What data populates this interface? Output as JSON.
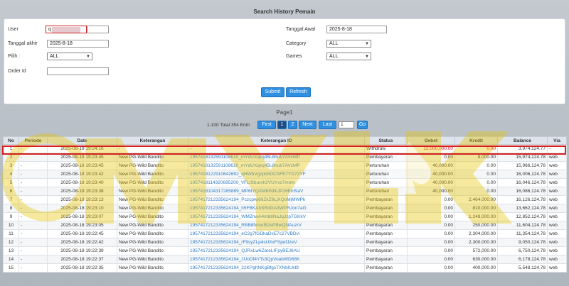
{
  "page_title": "Search History Pemain",
  "form": {
    "user_label": "User",
    "user_value": "q",
    "tanggal_awal_label": "Tanggal Awal",
    "tanggal_awal_value": "2025-8-18",
    "tanggal_akhir_label": "Tanggal akhir",
    "tanggal_akhir_value": "2025-8-18",
    "category_label": "Category",
    "category_value": "ALL",
    "pilih_label": "Pilih :",
    "pilih_value": "ALL",
    "games_label": "Games",
    "games_value": "ALL",
    "order_label": "Order Id",
    "order_value": "",
    "submit_label": "Submit",
    "refresh_label": "Refresh"
  },
  "pagination": {
    "page_label": "Page1",
    "range_text": "1-100 Total 354 Entri",
    "first_label": "First",
    "page1": "1",
    "page2": "2",
    "next_label": "Next",
    "last_label": "Last",
    "goto_value": "1",
    "go_label": "Go"
  },
  "table": {
    "headers": [
      "No",
      "Periode",
      "Date",
      "Keterangan",
      "Keterangan ID",
      "Status",
      "Debet",
      "Kredit",
      "Balance",
      "Via"
    ],
    "rows": [
      [
        "1",
        "-",
        "2025-08-18 19:24:16",
        "-",
        "-",
        "Withdraw",
        "12,000,000.00",
        "0.00",
        "3,974,124.77",
        "-"
      ],
      [
        "2",
        "-",
        "2025-08-18 19:23:45",
        "New PG-Wild Bandito",
        "1957418132591108610_mYdUXqkq45L8hub7AVcMP",
        "Pembayaran",
        "0.00",
        "8,000.00",
        "15,974,124.78",
        "web"
      ],
      [
        "3",
        "-",
        "2025-08-18 19:23:45",
        "New PG-Wild Bandito",
        "1957418132591108610_mYdUXqkq45L8hub7AVcMP",
        "Perturuhan",
        "40,000.00",
        "0.00",
        "15,966,124.78",
        "web"
      ],
      [
        "4",
        "-",
        "2025-08-18 19:23:42",
        "New PG-Wild Bandito",
        "1957418122910642692_qHWbVgzpb5DCSFE7YD72YF",
        "Perturuhan",
        "40,000.00",
        "0.00",
        "16,006,124.78",
        "web"
      ],
      [
        "5",
        "-",
        "2025-08-18 19:23:40",
        "New PG-Wild Bandito",
        "1957418114320695200_VFLtSburxh2VUYxz7mnm",
        "Perturuhan",
        "40,000.00",
        "0.00",
        "16,046,124.78",
        "web"
      ],
      [
        "6",
        "-",
        "2025-08-18 19:23:38",
        "New PG-Wild Bandito",
        "1957418104317285889_MP6tYQXMbINNiJP26EnSlaV",
        "Perturuhan",
        "40,000.00",
        "0.00",
        "16,086,124.78",
        "web"
      ],
      [
        "7",
        "-",
        "2025-08-18 19:23:13",
        "New PG-Wild Bandito",
        "1957417212335624194_Pczcpwj69ZkZ9LjXQoMjMWPk",
        "Pembayaran",
        "0.00",
        "2,464,000.00",
        "16,126,124.78",
        "web"
      ],
      [
        "8",
        "-",
        "2025-08-18 19:23:10",
        "New PG-Wild Bandito",
        "1957417212335624194_h5FBKAhSRdGA3WPRJon7aG",
        "Pembayaran",
        "0.00",
        "810,000.00",
        "13,662,124.78",
        "web"
      ],
      [
        "9",
        "-",
        "2025-08-18 19:23:07",
        "New PG-Wild Bandito",
        "1957417212335624194_WMZnwA4mb8NaJqJzpTGKkV",
        "Pembayaran",
        "0.00",
        "1,248,000.00",
        "12,852,124.78",
        "web"
      ],
      [
        "10",
        "-",
        "2025-08-18 19:23:05",
        "New PG-Wild Bandito",
        "1957417212335624194_RBB8fxmuf62ePBwQNAuzrV",
        "Pembayaran",
        "0.00",
        "250,000.00",
        "11,604,124.78",
        "web"
      ],
      [
        "11",
        "-",
        "2025-08-18 19:22:45",
        "New PG-Wild Bandito",
        "1957417212335624194_eC2g7fGDkaDxE7c27VBDvi",
        "Pembayaran",
        "0.00",
        "2,304,000.00",
        "11,354,124.78",
        "web"
      ],
      [
        "12",
        "-",
        "2025-08-18 19:22:42",
        "New PG-Wild Bandito",
        "1957417212335624194_rF9syZLp4sUXxFSpefJzeV",
        "Pembayaran",
        "0.00",
        "2,300,000.00",
        "9,050,124.78",
        "web"
      ],
      [
        "13",
        "-",
        "2025-08-18 19:22:39",
        "New PG-Wild Bandito",
        "1957417212335624194_QJRxLw6ZareLtFpyBEJ6AU",
        "Pembayaran",
        "0.00",
        "572,000.00",
        "6,750,124.78",
        "web"
      ],
      [
        "14",
        "-",
        "2025-08-18 19:22:37",
        "New PG-Wild Bandito",
        "1957417212335624194_JUoDf4YTs3QpVoabWD68K",
        "Pembayaran",
        "0.00",
        "630,000.00",
        "6,178,124.78",
        "web"
      ],
      [
        "15",
        "-",
        "2025-08-18 19:22:35",
        "New PG-Wild Bandito",
        "1957417212335624194_22KPghNKgBfgsTXNbIUkt9",
        "Pembayaran",
        "0.00",
        "400,000.00",
        "5,548,124.78",
        "web"
      ]
    ]
  },
  "colors": {
    "accent": "#2f8fe0",
    "highlight": "#d42020",
    "link": "#2f7dc8"
  }
}
